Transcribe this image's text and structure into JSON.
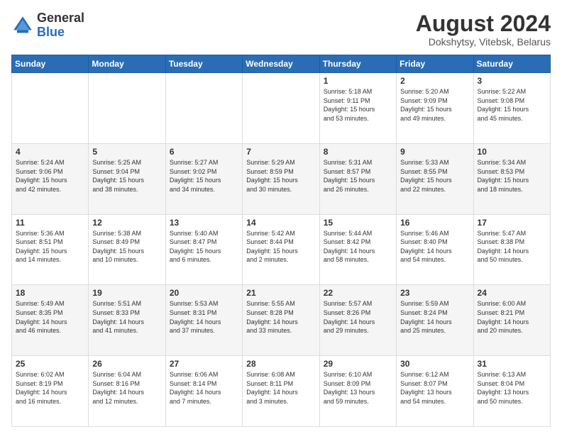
{
  "header": {
    "logo_general": "General",
    "logo_blue": "Blue",
    "month_year": "August 2024",
    "location": "Dokshytsy, Vitebsk, Belarus"
  },
  "days_of_week": [
    "Sunday",
    "Monday",
    "Tuesday",
    "Wednesday",
    "Thursday",
    "Friday",
    "Saturday"
  ],
  "weeks": [
    [
      {
        "day": "",
        "info": ""
      },
      {
        "day": "",
        "info": ""
      },
      {
        "day": "",
        "info": ""
      },
      {
        "day": "",
        "info": ""
      },
      {
        "day": "1",
        "info": "Sunrise: 5:18 AM\nSunset: 9:11 PM\nDaylight: 15 hours\nand 53 minutes."
      },
      {
        "day": "2",
        "info": "Sunrise: 5:20 AM\nSunset: 9:09 PM\nDaylight: 15 hours\nand 49 minutes."
      },
      {
        "day": "3",
        "info": "Sunrise: 5:22 AM\nSunset: 9:08 PM\nDaylight: 15 hours\nand 45 minutes."
      }
    ],
    [
      {
        "day": "4",
        "info": "Sunrise: 5:24 AM\nSunset: 9:06 PM\nDaylight: 15 hours\nand 42 minutes."
      },
      {
        "day": "5",
        "info": "Sunrise: 5:25 AM\nSunset: 9:04 PM\nDaylight: 15 hours\nand 38 minutes."
      },
      {
        "day": "6",
        "info": "Sunrise: 5:27 AM\nSunset: 9:02 PM\nDaylight: 15 hours\nand 34 minutes."
      },
      {
        "day": "7",
        "info": "Sunrise: 5:29 AM\nSunset: 8:59 PM\nDaylight: 15 hours\nand 30 minutes."
      },
      {
        "day": "8",
        "info": "Sunrise: 5:31 AM\nSunset: 8:57 PM\nDaylight: 15 hours\nand 26 minutes."
      },
      {
        "day": "9",
        "info": "Sunrise: 5:33 AM\nSunset: 8:55 PM\nDaylight: 15 hours\nand 22 minutes."
      },
      {
        "day": "10",
        "info": "Sunrise: 5:34 AM\nSunset: 8:53 PM\nDaylight: 15 hours\nand 18 minutes."
      }
    ],
    [
      {
        "day": "11",
        "info": "Sunrise: 5:36 AM\nSunset: 8:51 PM\nDaylight: 15 hours\nand 14 minutes."
      },
      {
        "day": "12",
        "info": "Sunrise: 5:38 AM\nSunset: 8:49 PM\nDaylight: 15 hours\nand 10 minutes."
      },
      {
        "day": "13",
        "info": "Sunrise: 5:40 AM\nSunset: 8:47 PM\nDaylight: 15 hours\nand 6 minutes."
      },
      {
        "day": "14",
        "info": "Sunrise: 5:42 AM\nSunset: 8:44 PM\nDaylight: 15 hours\nand 2 minutes."
      },
      {
        "day": "15",
        "info": "Sunrise: 5:44 AM\nSunset: 8:42 PM\nDaylight: 14 hours\nand 58 minutes."
      },
      {
        "day": "16",
        "info": "Sunrise: 5:46 AM\nSunset: 8:40 PM\nDaylight: 14 hours\nand 54 minutes."
      },
      {
        "day": "17",
        "info": "Sunrise: 5:47 AM\nSunset: 8:38 PM\nDaylight: 14 hours\nand 50 minutes."
      }
    ],
    [
      {
        "day": "18",
        "info": "Sunrise: 5:49 AM\nSunset: 8:35 PM\nDaylight: 14 hours\nand 46 minutes."
      },
      {
        "day": "19",
        "info": "Sunrise: 5:51 AM\nSunset: 8:33 PM\nDaylight: 14 hours\nand 41 minutes."
      },
      {
        "day": "20",
        "info": "Sunrise: 5:53 AM\nSunset: 8:31 PM\nDaylight: 14 hours\nand 37 minutes."
      },
      {
        "day": "21",
        "info": "Sunrise: 5:55 AM\nSunset: 8:28 PM\nDaylight: 14 hours\nand 33 minutes."
      },
      {
        "day": "22",
        "info": "Sunrise: 5:57 AM\nSunset: 8:26 PM\nDaylight: 14 hours\nand 29 minutes."
      },
      {
        "day": "23",
        "info": "Sunrise: 5:59 AM\nSunset: 8:24 PM\nDaylight: 14 hours\nand 25 minutes."
      },
      {
        "day": "24",
        "info": "Sunrise: 6:00 AM\nSunset: 8:21 PM\nDaylight: 14 hours\nand 20 minutes."
      }
    ],
    [
      {
        "day": "25",
        "info": "Sunrise: 6:02 AM\nSunset: 8:19 PM\nDaylight: 14 hours\nand 16 minutes."
      },
      {
        "day": "26",
        "info": "Sunrise: 6:04 AM\nSunset: 8:16 PM\nDaylight: 14 hours\nand 12 minutes."
      },
      {
        "day": "27",
        "info": "Sunrise: 6:06 AM\nSunset: 8:14 PM\nDaylight: 14 hours\nand 7 minutes."
      },
      {
        "day": "28",
        "info": "Sunrise: 6:08 AM\nSunset: 8:11 PM\nDaylight: 14 hours\nand 3 minutes."
      },
      {
        "day": "29",
        "info": "Sunrise: 6:10 AM\nSunset: 8:09 PM\nDaylight: 13 hours\nand 59 minutes."
      },
      {
        "day": "30",
        "info": "Sunrise: 6:12 AM\nSunset: 8:07 PM\nDaylight: 13 hours\nand 54 minutes."
      },
      {
        "day": "31",
        "info": "Sunrise: 6:13 AM\nSunset: 8:04 PM\nDaylight: 13 hours\nand 50 minutes."
      }
    ]
  ]
}
